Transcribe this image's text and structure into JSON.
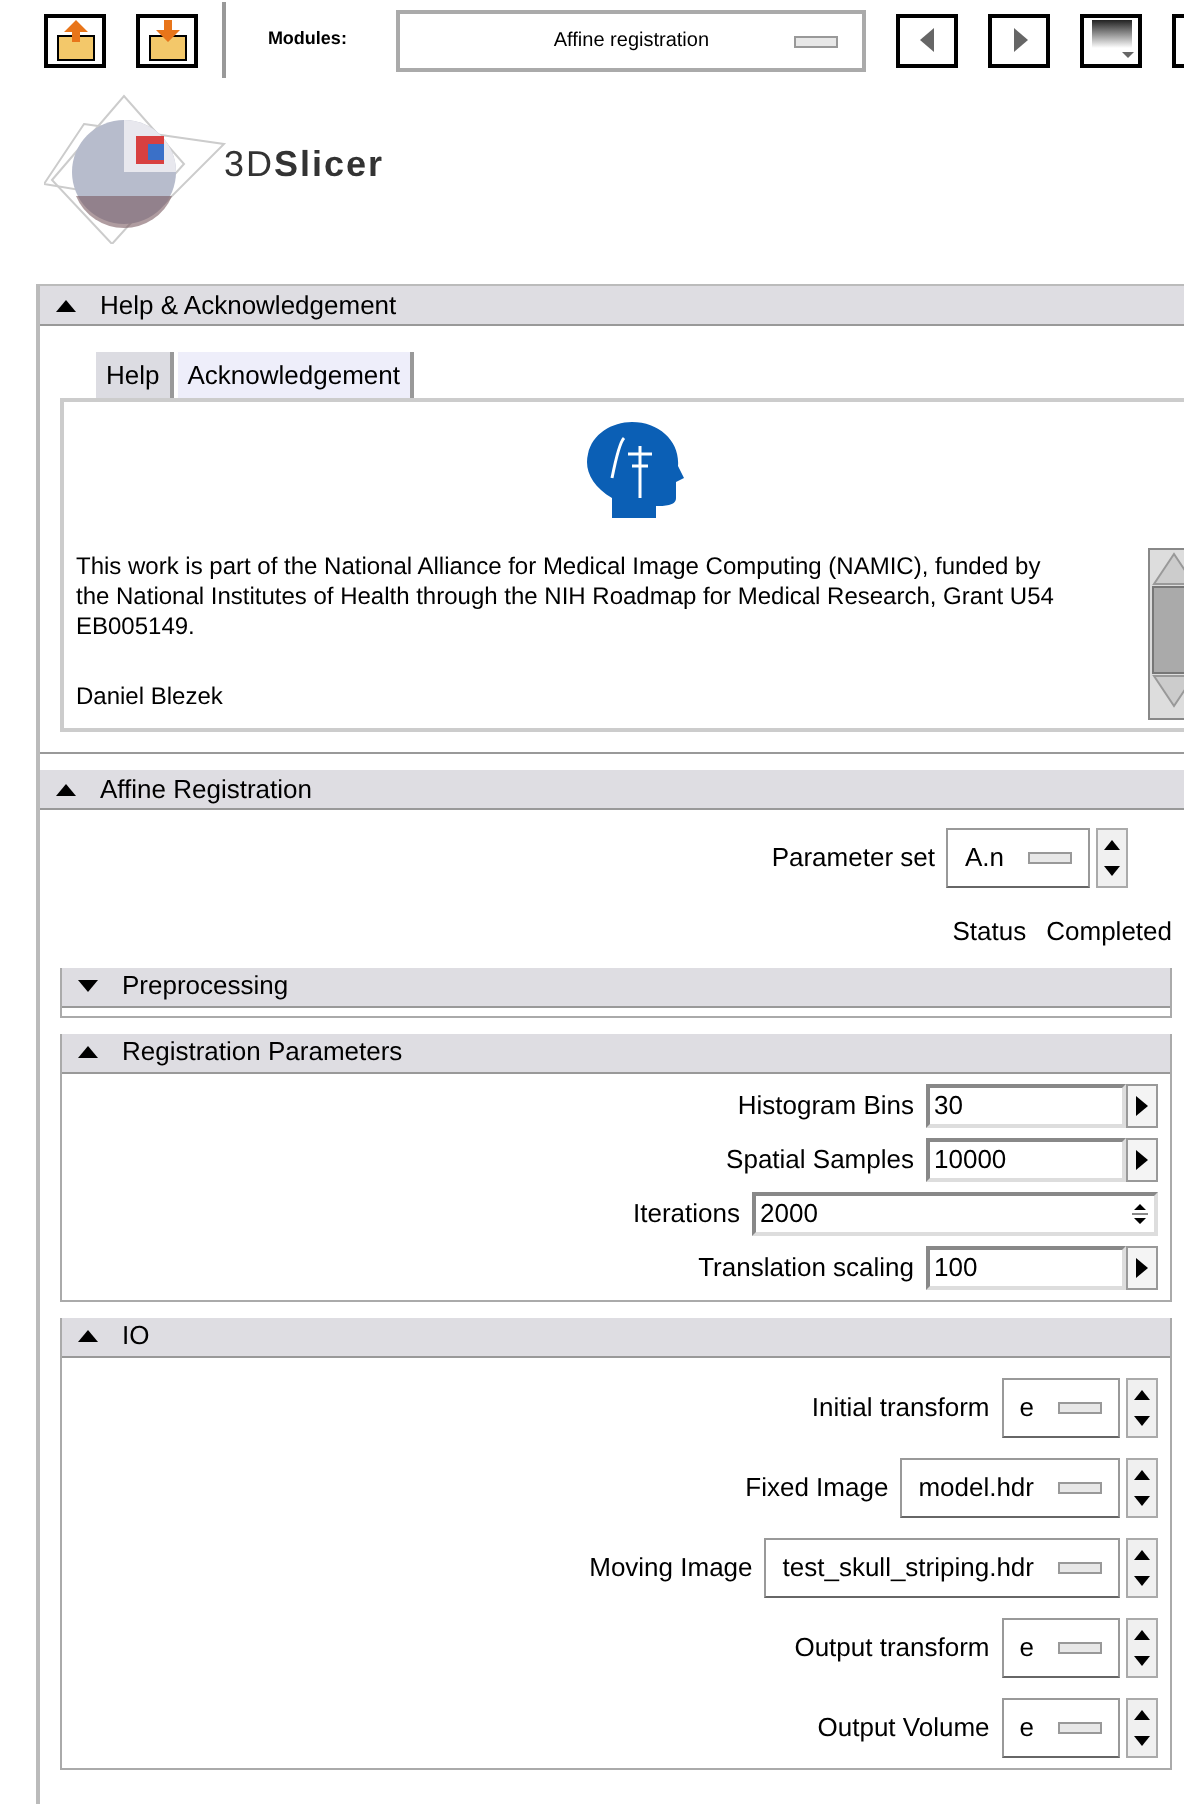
{
  "toolbar": {
    "modules_label": "Modules:",
    "module": "Affine registration"
  },
  "logo": {
    "text": "3D**Slicer**"
  },
  "help": {
    "title": "Help & Acknowledgement",
    "expanded": true,
    "tabs": [
      {
        "label": "Help",
        "selected": false
      },
      {
        "label": "Acknowledgement",
        "selected": true
      }
    ],
    "text": "This work is part of the National Alliance for Medical Image Computing (NAMIC), funded by the National Institutes of Health through the NIH Roadmap for Medical Research, Grant U54 EB005149.",
    "author": "Daniel Blezek"
  },
  "affine": {
    "title": "Affine Registration",
    "expanded": true,
    "parameter_set": {
      "label": "Parameter set",
      "value": "A.n"
    },
    "status": {
      "label": "Status",
      "value": "Completed"
    },
    "sections": [
      {
        "title": "Preprocessing",
        "expanded": false
      },
      {
        "title": "Registration Parameters",
        "expanded": true,
        "fields": [
          {
            "label": "Histogram Bins",
            "value": "30",
            "kind": "entry"
          },
          {
            "label": "Spatial Samples",
            "value": "10000",
            "kind": "entry"
          },
          {
            "label": "Iterations",
            "value": "2000",
            "kind": "spin"
          },
          {
            "label": "Translation scaling",
            "value": "100",
            "kind": "entry"
          }
        ]
      },
      {
        "title": "IO",
        "expanded": true,
        "fields": [
          {
            "label": "Initial transform",
            "value": "e",
            "kind": "menu"
          },
          {
            "label": "Fixed Image",
            "value": "model.hdr",
            "kind": "menu"
          },
          {
            "label": "Moving Image",
            "value": "test_skull_striping.hdr",
            "kind": "menu"
          },
          {
            "label": "Output transform",
            "value": "e",
            "kind": "menu"
          },
          {
            "label": "Output Volume",
            "value": "e",
            "kind": "menu"
          }
        ]
      }
    ]
  }
}
